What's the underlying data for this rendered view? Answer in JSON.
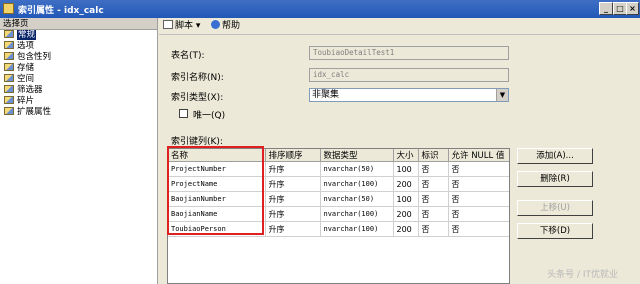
{
  "window": {
    "title": "索引属性 - idx_calc"
  },
  "sidebar": {
    "header": "选择页",
    "items": [
      {
        "label": "常规",
        "selected": true
      },
      {
        "label": "选项"
      },
      {
        "label": "包含性列"
      },
      {
        "label": "存储"
      },
      {
        "label": "空间"
      },
      {
        "label": "筛选器"
      },
      {
        "label": "碎片"
      },
      {
        "label": "扩展属性"
      }
    ]
  },
  "toolbar": {
    "script_label": "脚本",
    "help_label": "帮助"
  },
  "form": {
    "table_name_label": "表名(T):",
    "table_name_value": "ToubiaoDetailTest1",
    "index_name_label": "索引名称(N):",
    "index_name_value": "idx_calc",
    "index_type_label": "索引类型(X):",
    "index_type_value": "非聚集",
    "unique_label": "唯一(Q)",
    "unique_checked": false,
    "key_columns_label": "索引键列(K):"
  },
  "grid": {
    "headers": [
      "名称",
      "排序顺序",
      "数据类型",
      "大小",
      "标识",
      "允许 NULL 值"
    ],
    "rows": [
      [
        "ProjectNumber",
        "升序",
        "nvarchar(50)",
        "100",
        "否",
        "否"
      ],
      [
        "ProjectName",
        "升序",
        "nvarchar(100)",
        "200",
        "否",
        "否"
      ],
      [
        "BaojianNumber",
        "升序",
        "nvarchar(50)",
        "100",
        "否",
        "否"
      ],
      [
        "BaojianName",
        "升序",
        "nvarchar(100)",
        "200",
        "否",
        "否"
      ],
      [
        "ToubiaoPerson",
        "升序",
        "nvarchar(100)",
        "200",
        "否",
        "否"
      ]
    ]
  },
  "buttons": {
    "add": "添加(A)...",
    "remove": "删除(R)",
    "move_up": "上移(U)",
    "move_down": "下移(D)"
  },
  "watermark": "头条号 / IT优就业",
  "colors": {
    "titlebar": "#2358b8",
    "selection": "#0a246a",
    "highlight_box": "#e02020"
  }
}
